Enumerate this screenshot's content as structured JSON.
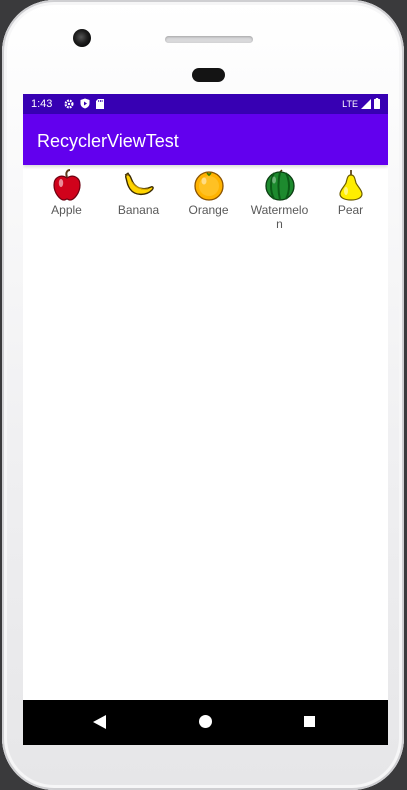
{
  "status_bar": {
    "time": "1:43",
    "network": "LTE",
    "left_icons": [
      "gear-icon",
      "shield-icon",
      "sd-card-icon"
    ],
    "right_icons": [
      "signal-icon",
      "battery-icon"
    ]
  },
  "app_bar": {
    "title": "RecyclerViewTest"
  },
  "fruits": [
    {
      "label": "Apple",
      "icon": "apple-icon"
    },
    {
      "label": "Banana",
      "icon": "banana-icon"
    },
    {
      "label": "Orange",
      "icon": "orange-icon"
    },
    {
      "label": "Watermelon",
      "icon": "watermelon-icon"
    },
    {
      "label": "Pear",
      "icon": "pear-icon"
    }
  ],
  "nav_bar": {
    "buttons": [
      "back-icon",
      "home-icon",
      "recents-icon"
    ]
  },
  "colors": {
    "status_bar": "#3700b3",
    "app_bar": "#6200ee"
  }
}
